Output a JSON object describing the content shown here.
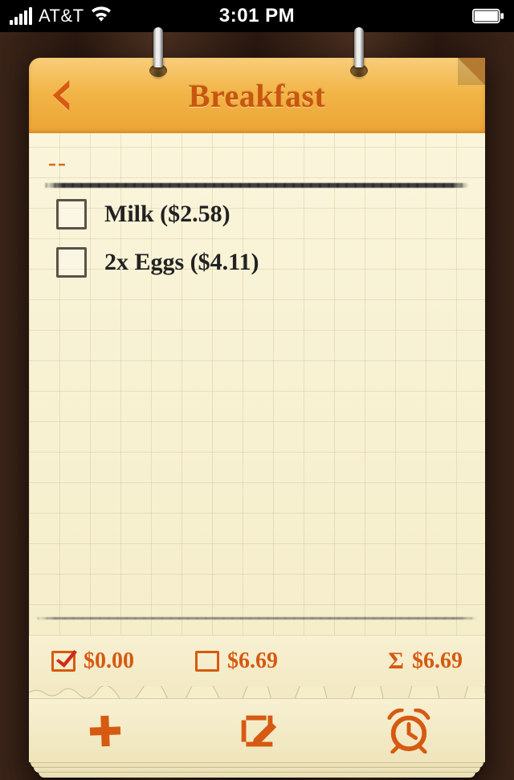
{
  "status": {
    "carrier": "AT&T",
    "time": "3:01 PM"
  },
  "header": {
    "title": "Breakfast"
  },
  "section": {
    "dash_label": "--"
  },
  "items": [
    {
      "label": "Milk ($2.58)",
      "checked": false
    },
    {
      "label": "2x Eggs ($4.11)",
      "checked": false
    }
  ],
  "summary": {
    "checked_total": "$0.00",
    "unchecked_total": "$6.69",
    "grand_total": "$6.69",
    "sigma": "Σ"
  },
  "colors": {
    "accent": "#d65a12"
  }
}
